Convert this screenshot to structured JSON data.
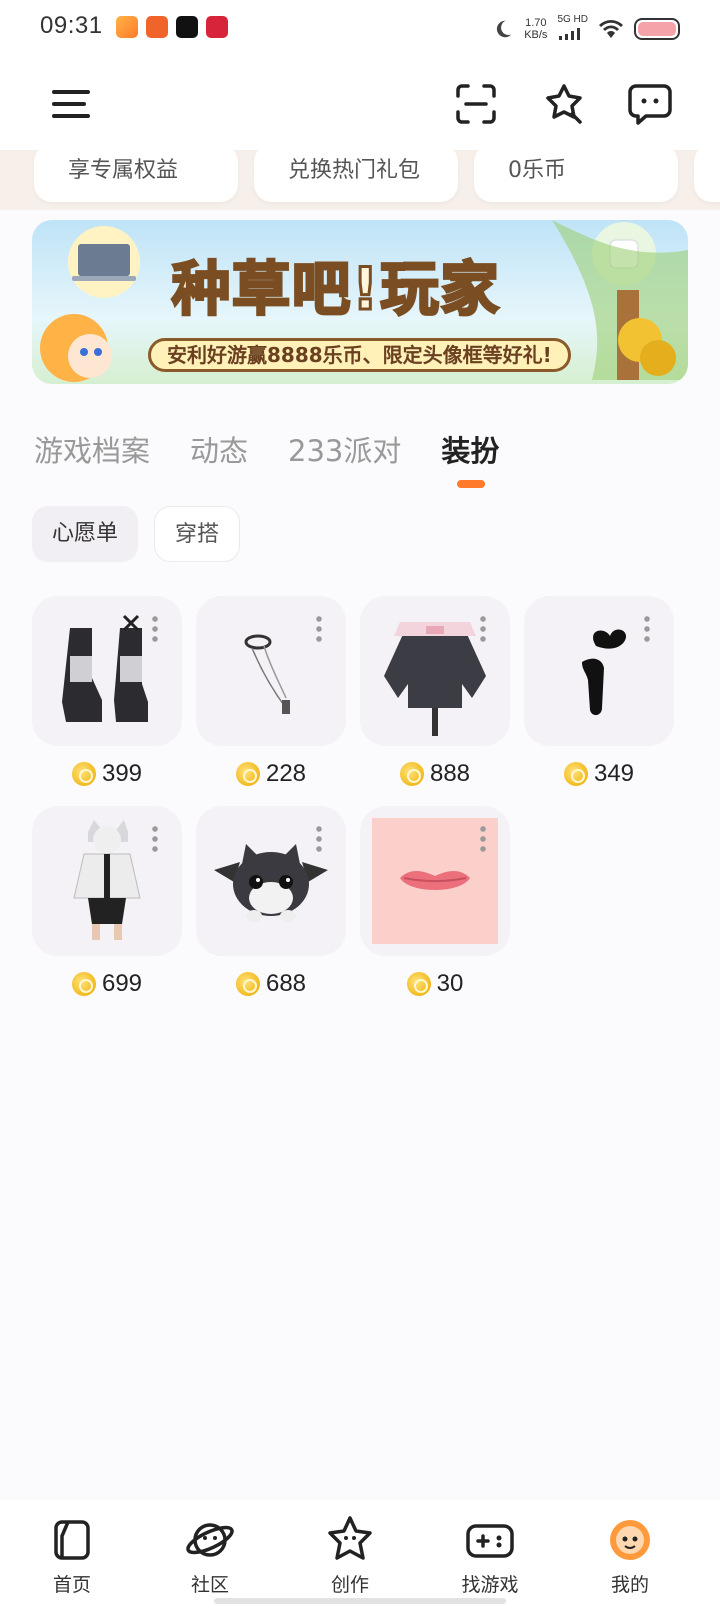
{
  "status_bar": {
    "time": "09:31",
    "net_speed_value": "1.70",
    "net_speed_unit": "KB/s",
    "network": "5G HD",
    "icons": [
      "video-app-icon",
      "photo-app-icon",
      "tiktok-icon",
      "heart-app-icon",
      "moon-icon",
      "signal-icon",
      "wifi-icon",
      "battery-icon"
    ],
    "battery_color": "#f4a3a8"
  },
  "top_nav": {
    "icons": [
      "menu-icon",
      "scan-icon",
      "star-icon",
      "message-icon"
    ]
  },
  "benefits": {
    "items": [
      "享专属权益",
      "兑换热门礼包",
      "0乐币"
    ]
  },
  "banner": {
    "title": "种草吧!玩家",
    "subtitle": "安利好游赢8888乐币、限定头像框等好礼!"
  },
  "tabs": {
    "items": [
      "游戏档案",
      "动态",
      "233派对",
      "装扮"
    ],
    "active_index": 3,
    "accent_color": "#ff7a2a"
  },
  "chips": {
    "items": [
      "心愿单",
      "穿搭"
    ],
    "active_index": 0
  },
  "items": [
    {
      "name": "boots",
      "price": "399"
    },
    {
      "name": "necklace",
      "price": "228"
    },
    {
      "name": "jacket",
      "price": "888"
    },
    {
      "name": "hair-accessory",
      "price": "349"
    },
    {
      "name": "outfit",
      "price": "699"
    },
    {
      "name": "cat-pet",
      "price": "688"
    },
    {
      "name": "lips",
      "price": "30"
    }
  ],
  "tabbar": {
    "items": [
      {
        "label": "首页",
        "icon": "home-icon"
      },
      {
        "label": "社区",
        "icon": "planet-icon"
      },
      {
        "label": "创作",
        "icon": "star-face-icon"
      },
      {
        "label": "找游戏",
        "icon": "gamepad-icon"
      },
      {
        "label": "我的",
        "icon": "profile-icon"
      }
    ],
    "active_index": 4,
    "active_color": "#ff8a2a"
  }
}
